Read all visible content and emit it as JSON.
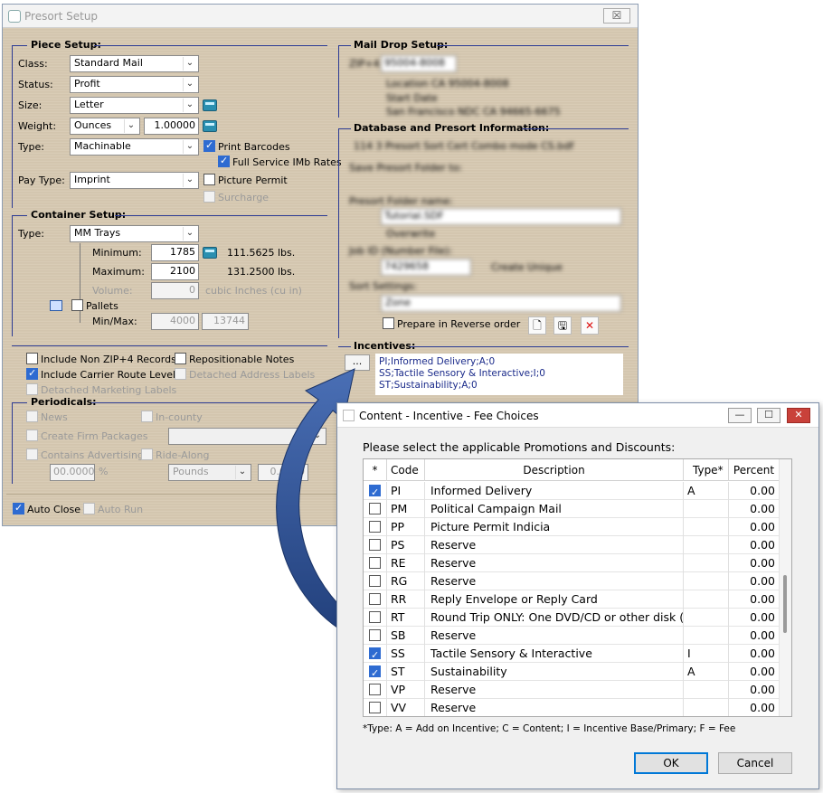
{
  "presort": {
    "title": "Presort Setup",
    "close_glyph": "☒",
    "piece_setup": {
      "title": "Piece Setup:",
      "class_label": "Class:",
      "class_value": "Standard Mail",
      "status_label": "Status:",
      "status_value": "Profit",
      "size_label": "Size:",
      "size_value": "Letter",
      "weight_label": "Weight:",
      "weight_unit": "Ounces",
      "weight_value": "1.00000",
      "type_label": "Type:",
      "type_value": "Machinable",
      "print_barcodes": "Print Barcodes",
      "full_service": "Full Service IMb Rates",
      "pay_type_label": "Pay Type:",
      "pay_type_value": "Imprint",
      "picture_permit": "Picture Permit",
      "surcharge": "Surcharge"
    },
    "container_setup": {
      "title": "Container Setup:",
      "type_label": "Type:",
      "type_value": "MM Trays",
      "minimum_label": "Minimum:",
      "minimum_value": "1785",
      "minimum_lbs": "111.5625 lbs.",
      "maximum_label": "Maximum:",
      "maximum_value": "2100",
      "maximum_lbs": "131.2500 lbs.",
      "volume_label": "Volume:",
      "volume_value": "0",
      "volume_unit": "cubic Inches (cu in)",
      "pallets": "Pallets",
      "minmax_label": "Min/Max:",
      "min_value": "4000",
      "max_value": "13744"
    },
    "options": {
      "include_non_zip4": "Include Non ZIP+4 Records",
      "repositionable_notes": "Repositionable Notes",
      "include_carrier_route": "Include Carrier Route Level",
      "detached_address": "Detached Address Labels",
      "detached_marketing": "Detached Marketing Labels"
    },
    "periodicals": {
      "title": "Periodicals:",
      "news": "News",
      "in_county": "In-county",
      "create_firm": "Create Firm Packages",
      "contains_advertising": "Contains Advertising",
      "ride_along": "Ride-Along",
      "advertising_pct": "00.0000",
      "pct_sign": "%",
      "ride_unit": "Pounds",
      "ride_value": "0.0000"
    },
    "auto_close": "Auto Close",
    "auto_run": "Auto Run",
    "mail_drop": {
      "title": "Mail Drop Setup:",
      "zip_label": "ZIP+4:",
      "zip_value": "95004-8008",
      "line1": "Location CA 95004-8008",
      "line2": "Start Date",
      "line3": "San Francisco NDC CA 94665-6675"
    },
    "database": {
      "title": "Database and Presort Information:",
      "path_text": "114 3 Presort Sort Cert Combo mode CS.bdf",
      "save_presort_label": "Save Presort Folder to:",
      "presort_folder_label": "Presort Folder name:",
      "presort_folder_value": "Tutorial.SDF",
      "overwrite": "Overwrite",
      "job_id_label": "Job ID (Number File):",
      "job_id_value": "7429658",
      "create_unique": "Create Unique",
      "sort_settings_label": "Sort Settings:",
      "sort_settings_value": "Zone",
      "prepare_reverse": "Prepare in Reverse order"
    },
    "incentives": {
      "title": "Incentives:",
      "dots": "...",
      "lines": [
        "PI;Informed Delivery;A;0",
        "SS;Tactile Sensory & Interactive;I;0",
        "ST;Sustainability;A;0"
      ]
    }
  },
  "dialog": {
    "title": "Content - Incentive - Fee Choices",
    "min_glyph": "—",
    "max_glyph": "☐",
    "close_glyph": "✕",
    "prompt": "Please select the applicable Promotions and Discounts:",
    "columns": [
      "*",
      "Code",
      "Description",
      "Type*",
      "Percent"
    ],
    "rows": [
      {
        "checked": true,
        "code": "PI",
        "description": "Informed Delivery",
        "type": "A",
        "percent": "0.00"
      },
      {
        "checked": false,
        "code": "PM",
        "description": "Political Campaign Mail",
        "type": "",
        "percent": "0.00"
      },
      {
        "checked": false,
        "code": "PP",
        "description": "Picture Permit Indicia",
        "type": "",
        "percent": "0.00"
      },
      {
        "checked": false,
        "code": "PS",
        "description": "Reserve",
        "type": "",
        "percent": "0.00"
      },
      {
        "checked": false,
        "code": "RE",
        "description": "Reserve",
        "type": "",
        "percent": "0.00"
      },
      {
        "checked": false,
        "code": "RG",
        "description": "Reserve",
        "type": "",
        "percent": "0.00"
      },
      {
        "checked": false,
        "code": "RR",
        "description": "Reply Envelope or Reply Card",
        "type": "",
        "percent": "0.00"
      },
      {
        "checked": false,
        "code": "RT",
        "description": "Round Trip ONLY: One DVD/CD or other disk (c",
        "type": "",
        "percent": "0.00"
      },
      {
        "checked": false,
        "code": "SB",
        "description": "Reserve",
        "type": "",
        "percent": "0.00"
      },
      {
        "checked": true,
        "code": "SS",
        "description": "Tactile Sensory & Interactive",
        "type": "I",
        "percent": "0.00"
      },
      {
        "checked": true,
        "code": "ST",
        "description": "Sustainability",
        "type": "A",
        "percent": "0.00"
      },
      {
        "checked": false,
        "code": "VP",
        "description": "Reserve",
        "type": "",
        "percent": "0.00"
      },
      {
        "checked": false,
        "code": "VV",
        "description": "Reserve",
        "type": "",
        "percent": "0.00"
      }
    ],
    "footnote": "*Type: A = Add on Incentive; C = Content; I = Incentive Base/Primary; F = Fee",
    "ok_label": "OK",
    "cancel_label": "Cancel"
  },
  "colors": {
    "accent": "#2c3b94",
    "arrow": "#2f4f8a",
    "check": "#2e6bd1"
  }
}
